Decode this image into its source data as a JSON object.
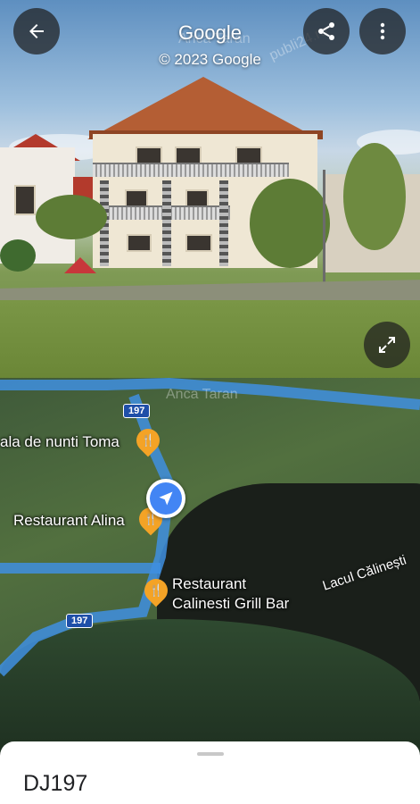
{
  "header": {
    "title": "Google",
    "copyright": "© 2023 Google",
    "author_watermark": "Anca Taran",
    "site_watermark": "publi24.ro"
  },
  "icons": {
    "back": "arrow-left-icon",
    "share": "share-icon",
    "more": "more-vert-icon",
    "expand": "expand-icon",
    "locator": "navigation-arrow-icon",
    "restaurant": "fork-knife-icon"
  },
  "map": {
    "road_number_1": "197",
    "road_number_2": "197",
    "watermark": "Anca Taran",
    "places": [
      {
        "label": "ala de nunti Toma"
      },
      {
        "label": "Restaurant Alina"
      },
      {
        "label_line1": "Restaurant",
        "label_line2": "Calinesti Grill Bar"
      }
    ],
    "lake_label": "Lacul Călinești"
  },
  "sheet": {
    "road_name": "DJ197"
  },
  "colors": {
    "road_highlight": "#3f8fe0",
    "pin": "#f4a326",
    "locator": "#4285f4"
  }
}
